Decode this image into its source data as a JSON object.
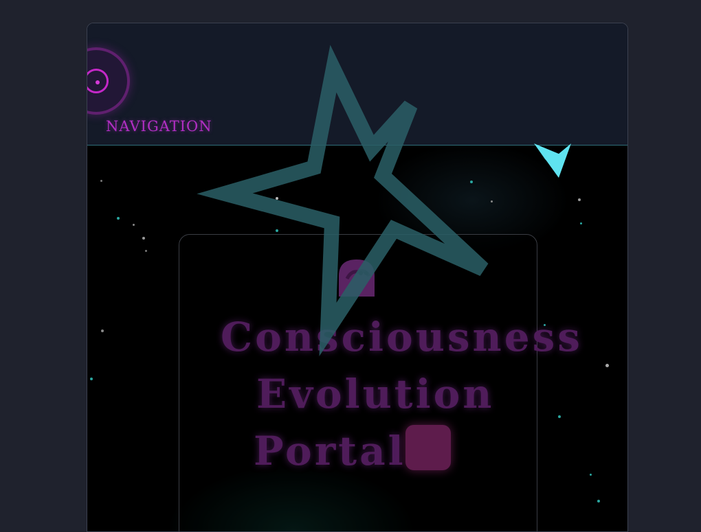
{
  "nav": {
    "label": "NAVIGATION",
    "logo_icon": "target-circle-icon"
  },
  "hero": {
    "title_line1": "Consciousness",
    "title_line2": "Evolution",
    "title_line3": "Portal",
    "icon": "brain-icon",
    "badge_icon": "square-badge-icon"
  },
  "decorations": {
    "star_icon": "star-outline-icon",
    "crystal_icon": "crystal-shard-icon"
  },
  "colors": {
    "page_background": "#1f222d",
    "nav_background": "#141a28",
    "accent_magenta": "#c428c8",
    "title_purple": "#4f1c5a",
    "star_teal": "#2a6a6e",
    "crystal_cyan": "#5fe3f0"
  }
}
